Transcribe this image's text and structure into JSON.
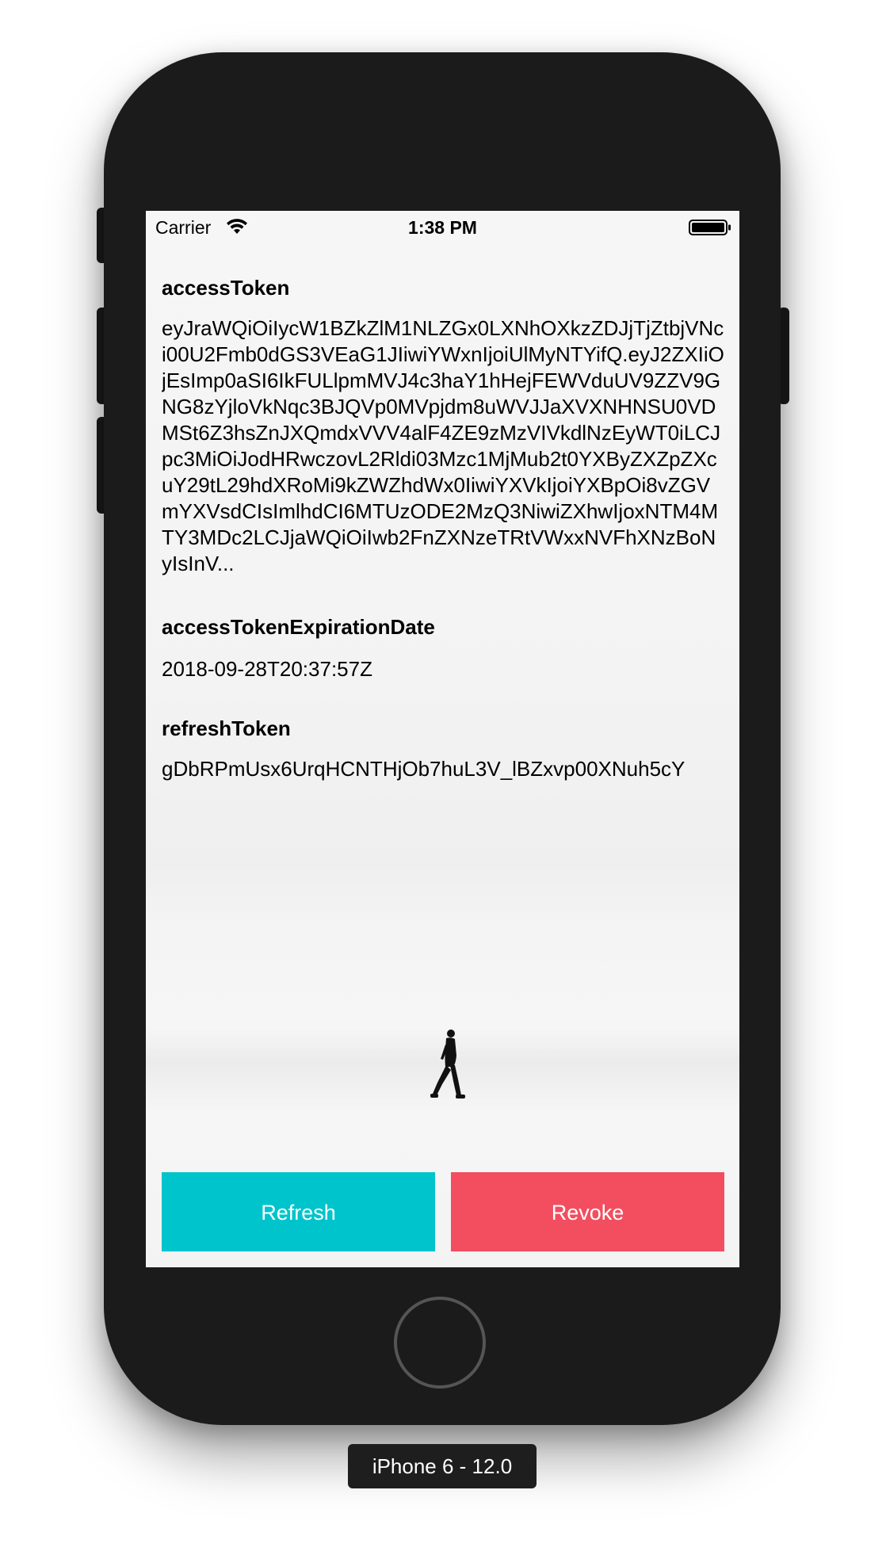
{
  "device": {
    "simulator_label": "iPhone 6 - 12.0"
  },
  "status_bar": {
    "carrier": "Carrier",
    "time": "1:38 PM",
    "wifi_icon": "wifi-icon",
    "battery_icon": "battery-icon"
  },
  "fields": {
    "access_token": {
      "label": "accessToken",
      "value": "eyJraWQiOiIycW1BZkZlM1NLZGx0LXNhOXkzZDJjTjZtbjVNci00U2Fmb0dGS3VEaG1JIiwiYWxnIjoiUlMyNTYifQ.eyJ2ZXIiOjEsImp0aSI6IkFULlpmMVJ4c3haY1hHejFEWVduUV9ZZV9GNG8zYjloVkNqc3BJQVp0MVpjdm8uWVJJaXVXNHNSU0VDMSt6Z3hsZnJXQmdxVVV4alF4ZE9zMzVIVkdlNzEyWT0iLCJpc3MiOiJodHRwczovL2Rldi03Mzc1MjMub2t0YXByZXZpZXcuY29tL29hdXRoMi9kZWZhdWx0IiwiYXVkIjoiYXBpOi8vZGVmYXVsdCIsImlhdCI6MTUzODE2MzQ3NiwiZXhwIjoxNTM4MTY3MDc2LCJjaWQiOiIwb2FnZXNzeTRtVWxxNVFhXNzBoNyIsInV..."
    },
    "access_token_expiration": {
      "label": "accessTokenExpirationDate",
      "value": "2018-09-28T20:37:57Z"
    },
    "refresh_token": {
      "label": "refreshToken",
      "value": "gDbRPmUsx6UrqHCNTHjOb7huL3V_lBZxvp00XNuh5cY"
    }
  },
  "buttons": {
    "refresh_label": "Refresh",
    "revoke_label": "Revoke"
  },
  "colors": {
    "refresh": "#00c4cc",
    "revoke": "#f24e5f",
    "device_frame": "#1b1b1b"
  }
}
